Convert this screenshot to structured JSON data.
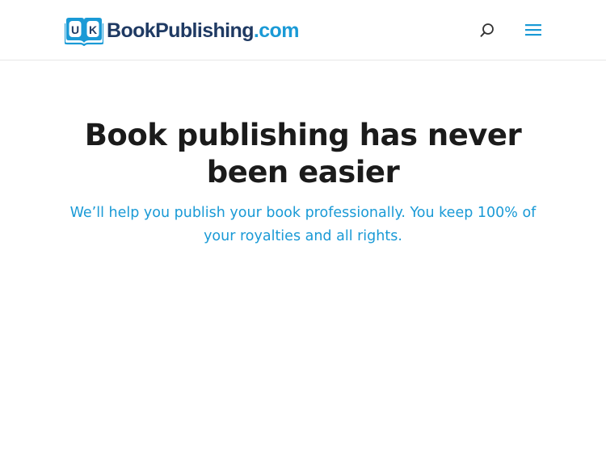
{
  "header": {
    "logo": {
      "mark_letters": [
        "U",
        "K"
      ],
      "brand": "BookPublishing",
      "tld": ".com"
    },
    "search_icon": "search-icon",
    "menu_icon": "hamburger-menu-icon"
  },
  "hero": {
    "title": "Book publishing has never been easier",
    "subtitle": "We’ll help you publish your book professionally. You keep 100% of your royalties and all rights."
  },
  "colors": {
    "brand_dark": "#1f3a63",
    "accent_blue": "#1a9ad6",
    "heading": "#1b1b1b"
  }
}
